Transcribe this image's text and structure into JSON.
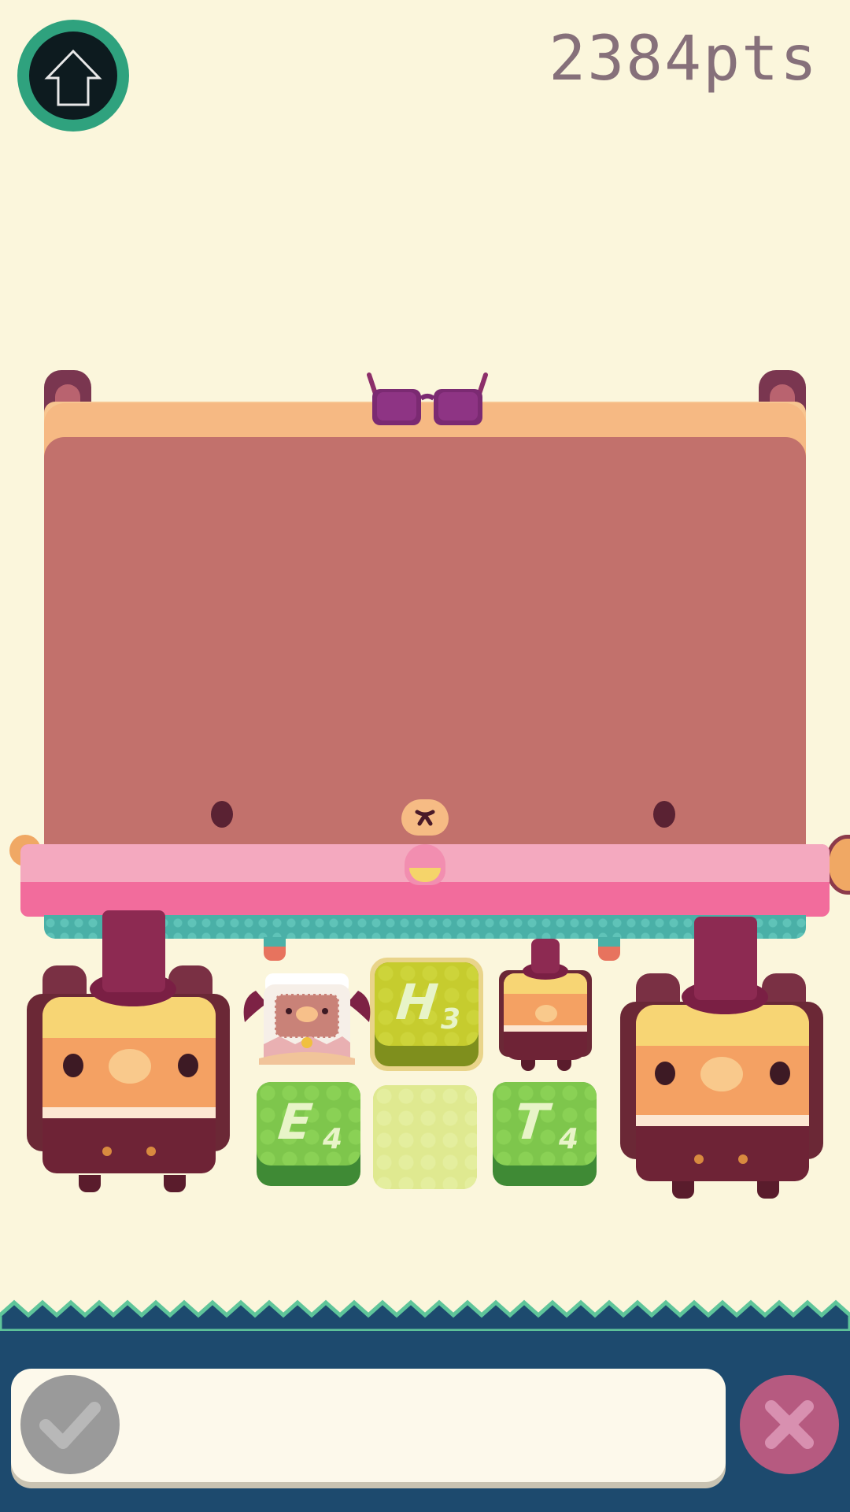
{
  "header": {
    "home_icon": "home-up-arrow-icon",
    "score": "2384pts"
  },
  "board": {
    "tiles": [
      {
        "letter": "H",
        "value": "3",
        "color": "yellow"
      },
      {
        "letter": "E",
        "value": "4",
        "color": "green"
      },
      {
        "letter": "",
        "value": "",
        "color": "empty"
      },
      {
        "letter": "T",
        "value": "4",
        "color": "green"
      }
    ]
  },
  "word_bar": {
    "current_word": "",
    "submit_icon": "checkmark-icon",
    "cancel_icon": "close-x-icon"
  },
  "colors": {
    "background": "#fbf6dc",
    "creature_face": "#c2716c",
    "panel": "#1d4a6e",
    "tile_green": "#7ec64c",
    "tile_yellow": "#c6cc2e",
    "cancel": "#b65a80",
    "submit": "#9a9a9a"
  }
}
